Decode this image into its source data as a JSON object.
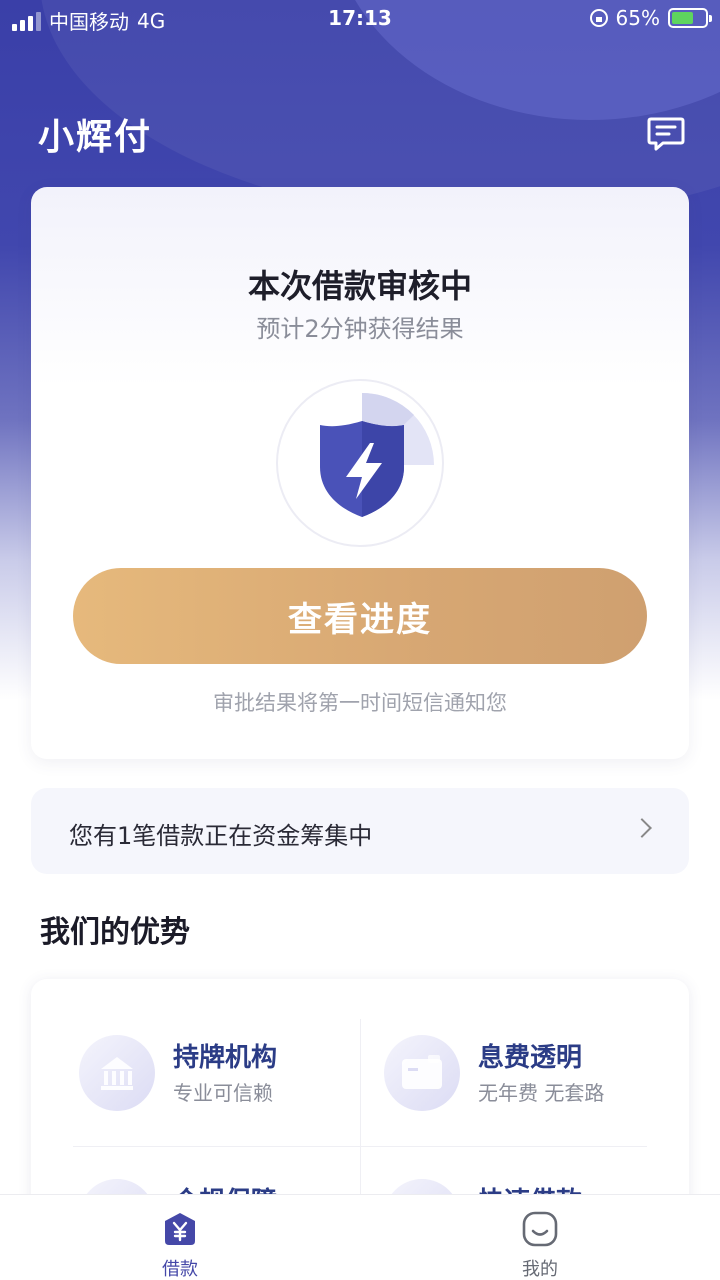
{
  "status_bar": {
    "carrier": "中国移动",
    "network": "4G",
    "time": "17:13",
    "battery": "65%",
    "battery_level": 0.65
  },
  "header": {
    "title": "小辉付",
    "message_icon": "message-icon"
  },
  "status_card": {
    "title": "本次借款审核中",
    "subtitle": "预计2分钟获得结果",
    "icon": "shield-lightning-icon",
    "button_label": "查看进度",
    "note": "审批结果将第一时间短信通知您"
  },
  "loan_notice": {
    "text": "您有1笔借款正在资金筹集中",
    "icon": "chevron-right-icon"
  },
  "advantages": {
    "title": "我们的优势",
    "items": [
      {
        "title": "持牌机构",
        "subtitle": "专业可信赖",
        "icon": "bank-icon"
      },
      {
        "title": "息费透明",
        "subtitle": "无年费 无套路",
        "icon": "wallet-icon"
      },
      {
        "title": "合规保障",
        "subtitle": "",
        "icon": "shield-icon"
      },
      {
        "title": "快速借款",
        "subtitle": "",
        "icon": "clock-icon"
      }
    ]
  },
  "tab_bar": {
    "tabs": [
      {
        "label": "借款",
        "icon": "yen-icon",
        "active": true
      },
      {
        "label": "我的",
        "icon": "smiley-icon",
        "active": false
      }
    ]
  },
  "colors": {
    "primary": "#3f45ad",
    "button_gold": "#dcae77",
    "accent_text": "#2b3c86"
  }
}
